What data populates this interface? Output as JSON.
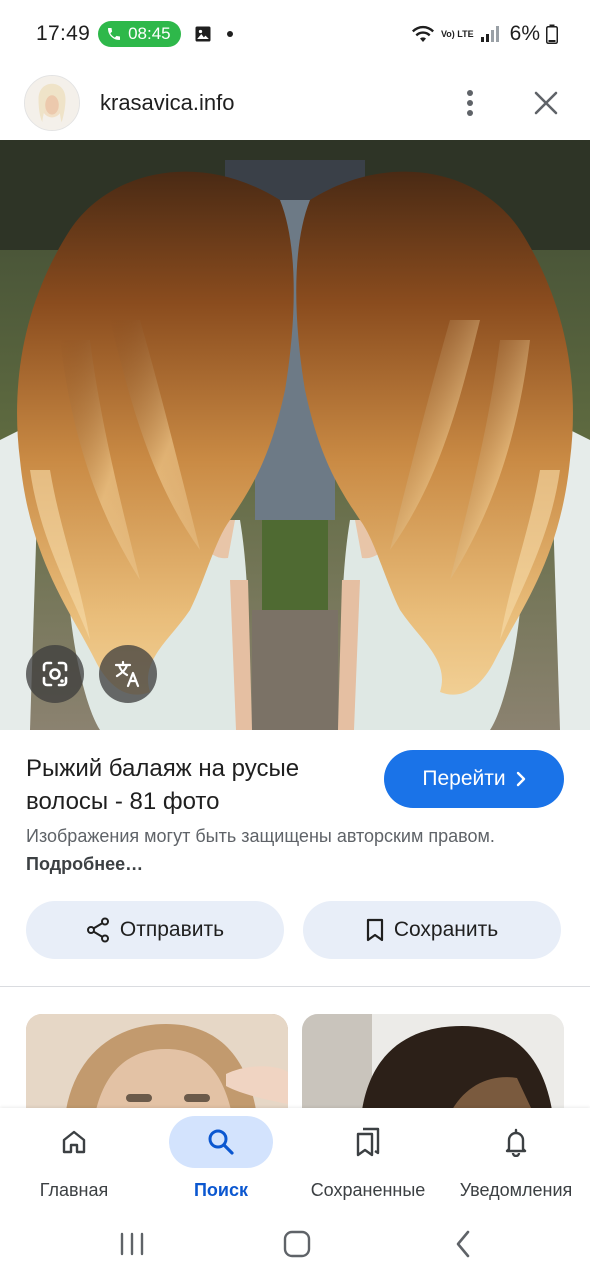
{
  "status_bar": {
    "time": "17:49",
    "call_time": "08:45",
    "network": "Vo) LTE",
    "battery": "6%"
  },
  "header": {
    "site_name": "krasavica.info"
  },
  "result": {
    "title": "Рыжий балаяж на русые волосы - 81 фото",
    "visit_label": "Перейти",
    "copyright_text": "Изображения могут быть защищены авторским правом.",
    "copyright_more": "Подробнее…",
    "share_label": "Отправить",
    "save_label": "Сохранить"
  },
  "bottom_nav": {
    "items": [
      {
        "label": "Главная",
        "icon": "home-icon"
      },
      {
        "label": "Поиск",
        "icon": "search-icon",
        "active": true
      },
      {
        "label": "Сохраненные",
        "icon": "collections-icon"
      },
      {
        "label": "Уведомления",
        "icon": "bell-icon"
      }
    ]
  },
  "colors": {
    "accent": "#1a73e8",
    "chip_bg": "#e8eef8",
    "call_pill": "#2eb84a",
    "nav_active_bg": "#d3e3fd"
  }
}
